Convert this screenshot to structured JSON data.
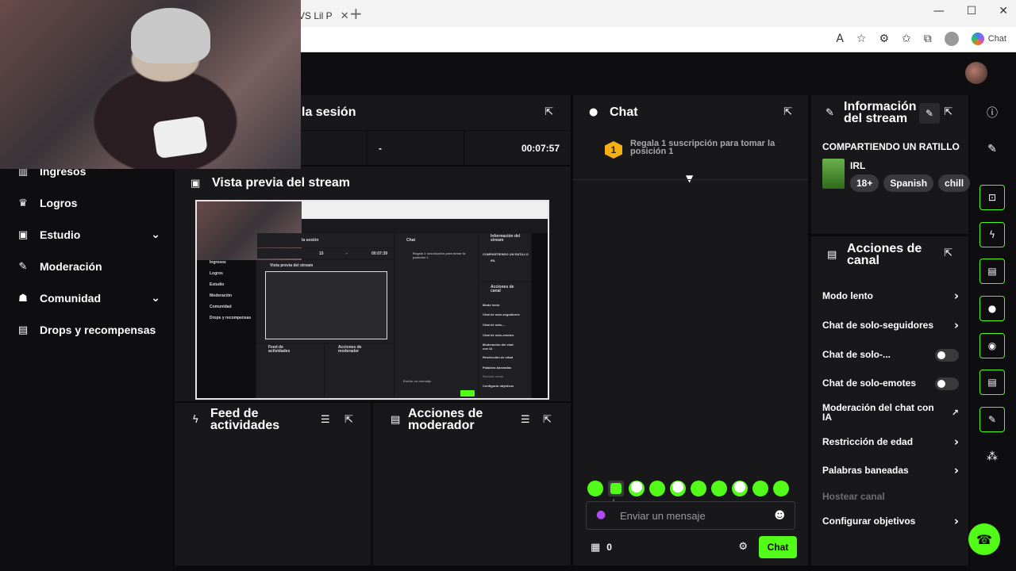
{
  "browser": {
    "tab_title": "VS Lil P",
    "tab_close": "✕",
    "new_tab": "+",
    "window_buttons": [
      "—",
      "☐",
      "✕"
    ],
    "copilot_label": "Chat"
  },
  "sidebar": {
    "items": [
      {
        "label": "Ingresos",
        "icon": "chart-icon",
        "glyph": "▥",
        "has_chevron": false
      },
      {
        "label": "Logros",
        "icon": "trophy-icon",
        "glyph": "♛",
        "has_chevron": false
      },
      {
        "label": "Estudio",
        "icon": "studio-icon",
        "glyph": "▣",
        "has_chevron": true
      },
      {
        "label": "Moderación",
        "icon": "wrench-icon",
        "glyph": "✎",
        "has_chevron": false
      },
      {
        "label": "Comunidad",
        "icon": "community-icon",
        "glyph": "☗",
        "has_chevron": true
      },
      {
        "label": "Drops y recompensas",
        "icon": "drops-icon",
        "glyph": "▤",
        "has_chevron": false
      }
    ]
  },
  "session": {
    "title": "la sesión",
    "stats": [
      "",
      "15",
      "-",
      "00:07:57"
    ]
  },
  "preview": {
    "title": "Vista previa del stream",
    "mini": {
      "session": "la sesión",
      "chat": "Chat",
      "info": "Información del stream",
      "preview": "Vista previa del stream",
      "sharing": "COMPARTIENDO UN RATILLO",
      "gift": "Regala 1 suscripción para tomar la posición 1",
      "feed": "Feed de actividades",
      "mod": "Acciones de moderador",
      "canal": "Acciones de canal",
      "input": "Enviar un mensaje",
      "stat_viewers": "15",
      "stat_dash": "-",
      "stat_time": "00:07:39",
      "tag_irl": "IRL",
      "sidebar_items": [
        "Ingresos",
        "Logros",
        "Estudio",
        "Moderación",
        "Comunidad",
        "Drops y recompensas"
      ],
      "canal_items": [
        "Modo lento",
        "Chat de solo-seguidores",
        "Chat de solo-...",
        "Chat de solo-emotes",
        "Moderación del chat con IA",
        "Restricción de edad",
        "Palabras baneadas",
        "Hostear canal",
        "Configurar objetivos"
      ]
    }
  },
  "feed": {
    "title": "Feed de actividades"
  },
  "mod_actions": {
    "title": "Acciones de moderador"
  },
  "chat": {
    "title": "Chat",
    "gift_rank": "1",
    "gift_text": "Regala 1 suscripción para tomar la posición 1",
    "input_placeholder": "Enviar un mensaje",
    "count": "0",
    "send_label": "Chat"
  },
  "stream_info": {
    "title": "Información del stream",
    "stream_title": "COMPARTIENDO UN RATILLO",
    "category": "IRL",
    "tags": [
      "18+",
      "Spanish",
      "chill"
    ]
  },
  "channel_actions": {
    "title": "Acciones de canal",
    "items": [
      {
        "label": "Modo lento",
        "control": "chevron"
      },
      {
        "label": "Chat de solo-seguidores",
        "control": "chevron"
      },
      {
        "label": "Chat de solo-...",
        "control": "toggle"
      },
      {
        "label": "Chat de solo-emotes",
        "control": "toggle"
      },
      {
        "label": "Moderación del chat con IA",
        "control": "external"
      },
      {
        "label": "Restricción de edad",
        "control": "chevron"
      },
      {
        "label": "Palabras baneadas",
        "control": "chevron"
      },
      {
        "label": "Hostear canal",
        "control": "none"
      },
      {
        "label": "Configurar objetivos",
        "control": "chevron"
      }
    ]
  },
  "colors": {
    "accent": "#53fc18",
    "panel": "#18181b",
    "background": "#0b0b0c"
  }
}
